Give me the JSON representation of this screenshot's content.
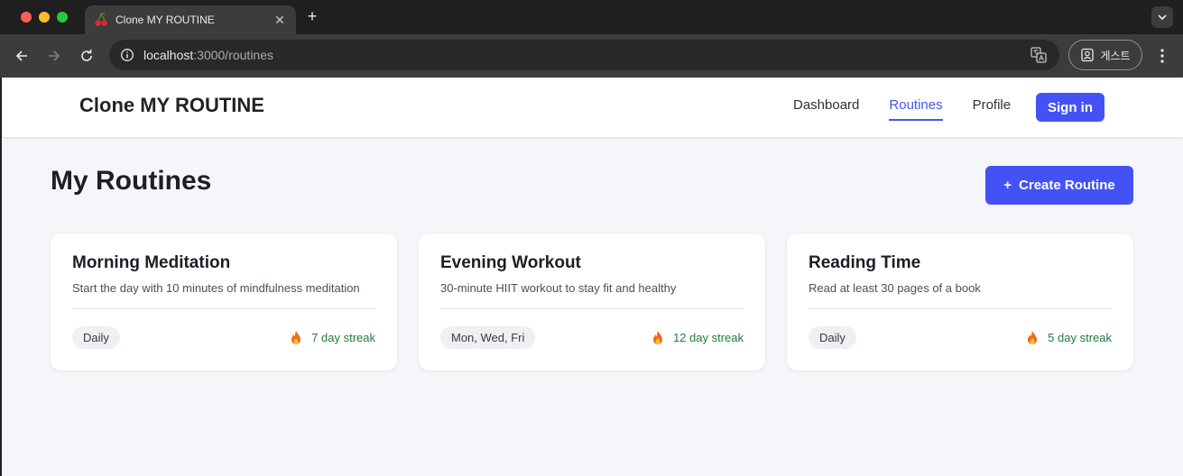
{
  "browser": {
    "tab_title": "Clone MY ROUTINE",
    "tab_close": "✕",
    "new_tab": "+",
    "url_host": "localhost",
    "url_path": ":3000/routines",
    "profile_label": "게스트"
  },
  "app": {
    "brand": "Clone MY ROUTINE",
    "nav": [
      {
        "label": "Dashboard",
        "active": false
      },
      {
        "label": "Routines",
        "active": true
      },
      {
        "label": "Profile",
        "active": false
      }
    ],
    "sign_in": "Sign in",
    "accent_color": "#4452f5",
    "streak_color": "#1f7a3f"
  },
  "main": {
    "heading": "My Routines",
    "create_button_icon": "+",
    "create_button_label": "Create Routine",
    "routines": [
      {
        "title": "Morning Meditation",
        "description": "Start the day with 10 minutes of mindfulness meditation",
        "schedule": "Daily",
        "streak": "7 day streak"
      },
      {
        "title": "Evening Workout",
        "description": "30-minute HIIT workout to stay fit and healthy",
        "schedule": "Mon, Wed, Fri",
        "streak": "12 day streak"
      },
      {
        "title": "Reading Time",
        "description": "Read at least 30 pages of a book",
        "schedule": "Daily",
        "streak": "5 day streak"
      }
    ]
  }
}
